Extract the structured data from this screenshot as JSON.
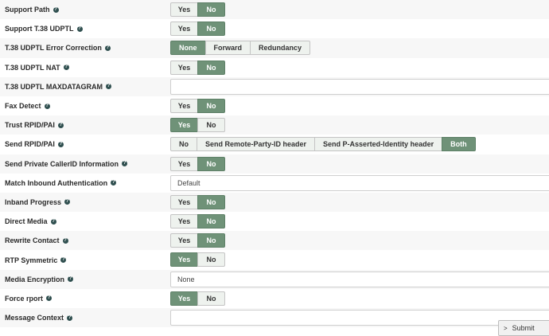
{
  "rows": [
    {
      "id": "support-path",
      "label": "Support Path",
      "help": "?",
      "type": "yesno",
      "yes": "Yes",
      "no": "No",
      "selected": "No"
    },
    {
      "id": "support-t38-udptl",
      "label": "Support T.38 UDPTL",
      "help": "?",
      "type": "yesno",
      "yes": "Yes",
      "no": "No",
      "selected": "No"
    },
    {
      "id": "t38-udptl-error-correction",
      "label": "T.38 UDPTL Error Correction",
      "help": "?",
      "type": "options",
      "options": [
        "None",
        "Forward",
        "Redundancy"
      ],
      "selected": "None"
    },
    {
      "id": "t38-udptl-nat",
      "label": "T.38 UDPTL NAT",
      "help": "?",
      "type": "yesno",
      "yes": "Yes",
      "no": "No",
      "selected": "No"
    },
    {
      "id": "t38-udptl-maxdatagram",
      "label": "T.38 UDPTL MAXDATAGRAM",
      "help": "?",
      "type": "text",
      "value": ""
    },
    {
      "id": "fax-detect",
      "label": "Fax Detect",
      "help": "?",
      "type": "yesno",
      "yes": "Yes",
      "no": "No",
      "selected": "No"
    },
    {
      "id": "trust-rpid-pai",
      "label": "Trust RPID/PAI",
      "help": "?",
      "type": "yesno",
      "yes": "Yes",
      "no": "No",
      "selected": "Yes"
    },
    {
      "id": "send-rpid-pai",
      "label": "Send RPID/PAI",
      "help": "?",
      "type": "options",
      "options": [
        "No",
        "Send Remote-Party-ID header",
        "Send P-Asserted-Identity header",
        "Both"
      ],
      "selected": "Both"
    },
    {
      "id": "send-private-callerid",
      "label": "Send Private CallerID Information",
      "help": "?",
      "type": "yesno",
      "yes": "Yes",
      "no": "No",
      "selected": "No"
    },
    {
      "id": "match-inbound-authentication",
      "label": "Match Inbound Authentication",
      "help": "?",
      "type": "select",
      "value": "Default"
    },
    {
      "id": "inband-progress",
      "label": "Inband Progress",
      "help": "?",
      "type": "yesno",
      "yes": "Yes",
      "no": "No",
      "selected": "No"
    },
    {
      "id": "direct-media",
      "label": "Direct Media",
      "help": "?",
      "type": "yesno",
      "yes": "Yes",
      "no": "No",
      "selected": "No"
    },
    {
      "id": "rewrite-contact",
      "label": "Rewrite Contact",
      "help": "?",
      "type": "yesno",
      "yes": "Yes",
      "no": "No",
      "selected": "No"
    },
    {
      "id": "rtp-symmetric",
      "label": "RTP Symmetric",
      "help": "?",
      "type": "yesno",
      "yes": "Yes",
      "no": "No",
      "selected": "Yes"
    },
    {
      "id": "media-encryption",
      "label": "Media Encryption",
      "help": "?",
      "type": "select",
      "value": "None"
    },
    {
      "id": "force-rport",
      "label": "Force rport",
      "help": "?",
      "type": "yesno",
      "yes": "Yes",
      "no": "No",
      "selected": "Yes"
    },
    {
      "id": "message-context",
      "label": "Message Context",
      "help": "?",
      "type": "text",
      "value": ""
    }
  ],
  "submit": {
    "label": "Submit",
    "chevron": ">"
  },
  "colors": {
    "selected": "#6f9278",
    "unselected": "#eef2ee",
    "row_alt": "#f7f7f7",
    "help_icon": "#2f4f4f"
  }
}
